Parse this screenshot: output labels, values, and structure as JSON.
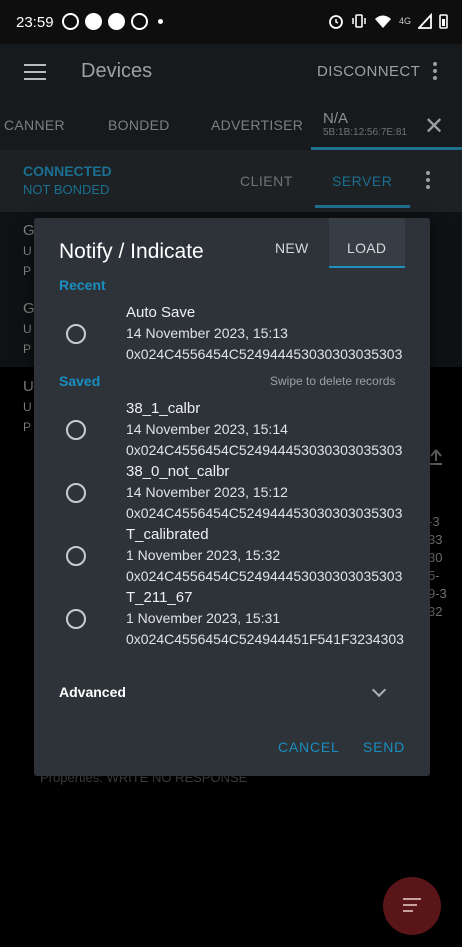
{
  "status_bar": {
    "time": "23:59",
    "network": "4G"
  },
  "app_bar": {
    "title": "Devices",
    "disconnect": "DISCONNECT"
  },
  "device_tabs": {
    "scanner": "CANNER",
    "bonded": "BONDED",
    "advertiser": "ADVERTISER",
    "active_name": "N/A",
    "active_mac": "5B:1B:12:56:7E:81"
  },
  "connection": {
    "state": "CONNECTED",
    "bond": "NOT BONDED",
    "client_tab": "CLIENT",
    "server_tab": "SERVER",
    "active_color": "#1b8ec0"
  },
  "background": {
    "letters": [
      "G",
      "U",
      "P",
      "G",
      "U",
      "P",
      "U",
      "U",
      "P"
    ],
    "fragments": [
      "-3",
      "33",
      "30",
      "5-",
      "9-3",
      "32"
    ],
    "props": "Properties: WRITE NO RESPONSE"
  },
  "dialog": {
    "title": "Notify / Indicate",
    "tab_new": "NEW",
    "tab_load": "LOAD",
    "recent_label": "Recent",
    "saved_label": "Saved",
    "swipe_hint": "Swipe to delete records",
    "recent": [
      {
        "name": "Auto Save",
        "date": "14 November 2023, 15:13",
        "hex": "0x024C4556454C524944453030303035303"
      }
    ],
    "saved": [
      {
        "name": "38_1_calbr",
        "date": "14 November 2023, 15:14",
        "hex": "0x024C4556454C524944453030303035303"
      },
      {
        "name": "38_0_not_calbr",
        "date": "14 November 2023, 15:12",
        "hex": "0x024C4556454C524944453030303035303"
      },
      {
        "name": "T_calibrated",
        "date": "1 November 2023, 15:32",
        "hex": "0x024C4556454C524944453030303035303"
      },
      {
        "name": "T_211_67",
        "date": "1 November 2023, 15:31",
        "hex": "0x024C4556454C524944451F541F3234303"
      }
    ],
    "advanced": "Advanced",
    "cancel": "CANCEL",
    "send": "SEND"
  }
}
